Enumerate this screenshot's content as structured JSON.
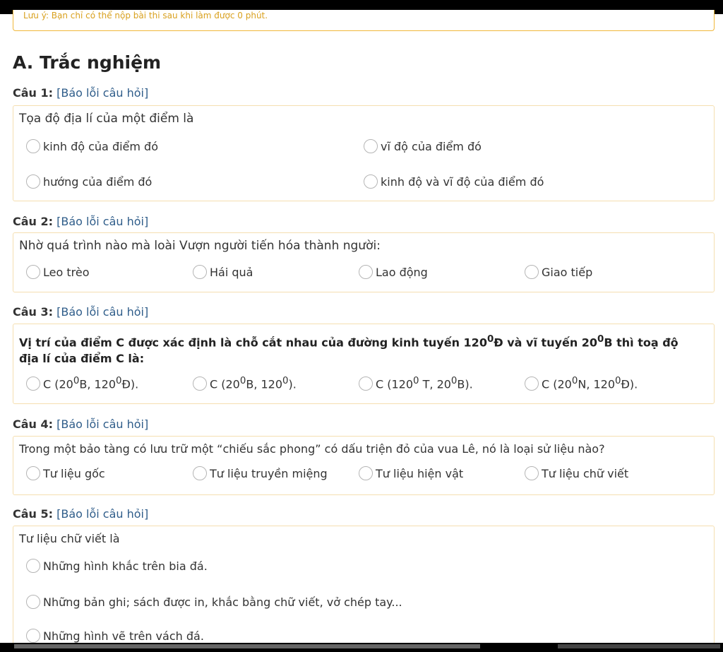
{
  "notice": "Lưu ý: Bạn chỉ có thể nộp bài thi sau khi làm được 0 phút.",
  "section_title": "A. Trắc nghiệm",
  "report_label": "[Báo lỗi câu hỏi]",
  "questions": [
    {
      "label": "Câu 1:",
      "text": "Tọa độ địa lí của một điểm là",
      "options": [
        "kinh độ của điểm đó",
        "vĩ độ của điểm đó",
        "hướng của điểm đó",
        "kinh độ và vĩ độ của điểm đó"
      ]
    },
    {
      "label": "Câu 2:",
      "text": "Nhờ quá trình nào mà loài Vượn người tiến hóa thành người:",
      "options": [
        "Leo trèo",
        "Hái quả",
        "Lao động",
        "Giao tiếp"
      ]
    },
    {
      "label": "Câu 3:",
      "text_a": "Vị trí của điểm C được xác định là chỗ cắt nhau của đường kinh tuyến ",
      "deg1": "120",
      "sup": "0",
      "text_b": "Đ và vĩ tuyến ",
      "deg2": "20",
      "text_c": "B thì toạ độ",
      "text_line2": "địa lí của điểm C là:",
      "options": [
        [
          "C (20",
          "0",
          "B, 120",
          "0",
          "Đ)."
        ],
        [
          "C (20",
          "0",
          "B, 120",
          "0",
          ")."
        ],
        [
          "C (120",
          "0",
          " T, 20",
          "0",
          "B)."
        ],
        [
          "C (20",
          "0",
          "N, 120",
          "0",
          "Đ)."
        ]
      ]
    },
    {
      "label": "Câu 4:",
      "text": "Trong một bảo tàng có lưu trữ một “chiếu sắc phong” có dấu triện đỏ của vua Lê, nó là loại sử liệu nào?",
      "options": [
        "Tư liệu gốc",
        "Tư liệu truyền miệng",
        "Tư liệu hiện vật",
        "Tư liệu chữ viết"
      ]
    },
    {
      "label": "Câu 5:",
      "text": "Tư liệu chữ viết là",
      "options": [
        "Những hình khắc trên bia đá.",
        "Những bản ghi; sách được in, khắc bằng chữ viết, vở chép tay...",
        "Những hình vẽ trên vách đá."
      ]
    }
  ]
}
